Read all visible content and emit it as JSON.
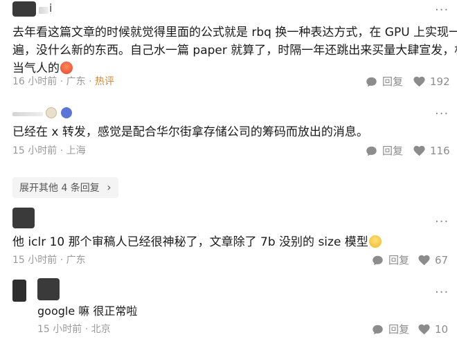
{
  "comments": [
    {
      "name_fragment": "i",
      "text_lines": [
        "去年看这篇文章的时候就觉得里面的公式就是 rbq 换一种表达方式，在 GPU 上实现一",
        "遍，没什么新的东西。自己水一篇 paper 就算了，时隔一年还跳出来买量大肆宣发，相",
        "当气人的"
      ],
      "time": "16 小时前",
      "sep": "·",
      "location": "广东",
      "hot": "热评",
      "reply_label": "回复",
      "likes": "192"
    },
    {
      "text_lines": [
        "已经在 x 转发，感觉是配合华尔街拿存储公司的筹码而放出的消息。"
      ],
      "time": "15 小时前",
      "sep": "·",
      "location": "上海",
      "reply_label": "回复",
      "likes": "116"
    },
    {
      "expand_label": "展开其他 4 条回复",
      "expand_chevron": "›"
    },
    {
      "text_lines": [
        "他 iclr 10 那个审稿人已经很神秘了，文章除了 7b 没别的 size 模型"
      ],
      "time": "15 小时前",
      "sep": "·",
      "location": "广东",
      "reply_label": "回复",
      "likes": "67"
    },
    {
      "text_lines": [
        "google 嘛 很正常啦"
      ],
      "time": "15 小时前",
      "sep": "·",
      "location": "北京",
      "reply_label": "回复",
      "likes": "10"
    }
  ],
  "icons": {
    "more": "more-dots-icon",
    "reply": "reply-bubble-icon",
    "like": "heart-icon"
  },
  "colors": {
    "hot": "#d0893b",
    "meta": "#999999",
    "text": "#1a1a1a"
  }
}
